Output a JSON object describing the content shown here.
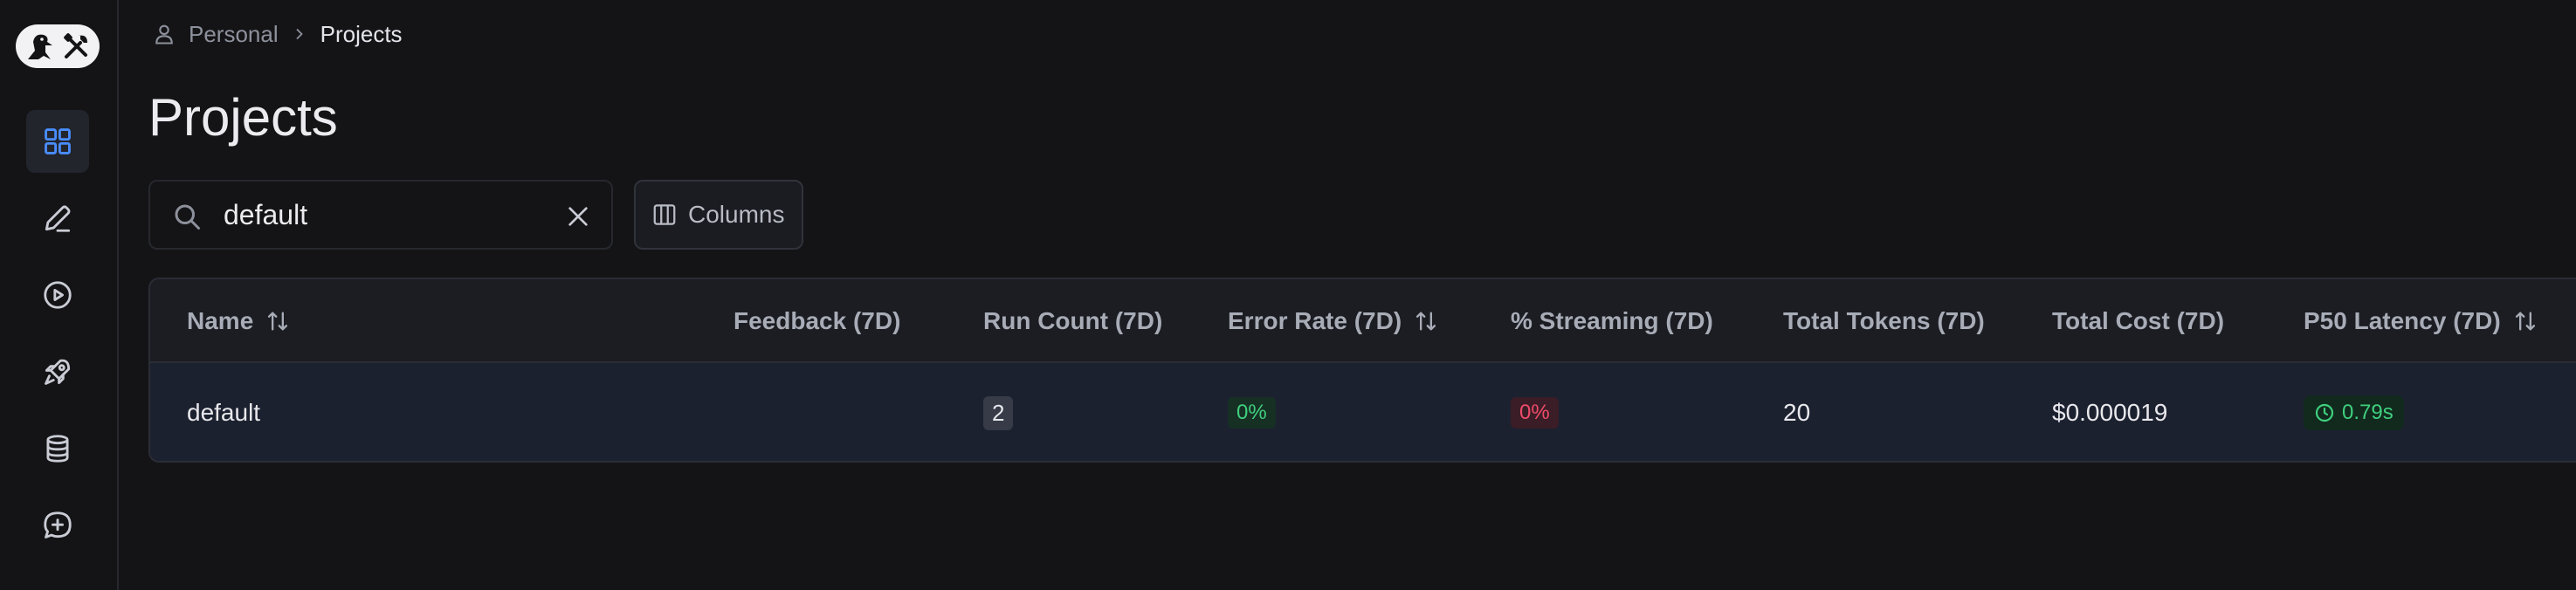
{
  "app": {
    "logo_alt": "LangSmith"
  },
  "sidebar": {
    "items": [
      {
        "icon": "grid-icon",
        "active": true
      },
      {
        "icon": "pencil-icon",
        "active": false
      },
      {
        "icon": "play-circle-icon",
        "active": false
      },
      {
        "icon": "rocket-icon",
        "active": false
      },
      {
        "icon": "database-icon",
        "active": false
      },
      {
        "icon": "chat-plus-icon",
        "active": false
      }
    ]
  },
  "breadcrumb": {
    "workspace": "Personal",
    "current": "Projects"
  },
  "page": {
    "title": "Projects"
  },
  "search": {
    "value": "default",
    "placeholder": ""
  },
  "toolbar": {
    "columns_label": "Columns"
  },
  "table": {
    "headers": [
      "Name",
      "Feedback (7D)",
      "Run Count (7D)",
      "Error Rate (7D)",
      "% Streaming (7D)",
      "Total Tokens (7D)",
      "Total Cost (7D)",
      "P50 Latency (7D)"
    ],
    "rows": [
      {
        "name": "default",
        "feedback": "",
        "run_count": "2",
        "error_rate": "0%",
        "streaming": "0%",
        "total_tokens": "20",
        "total_cost": "$0.000019",
        "p50_latency": "0.79s"
      }
    ]
  },
  "colors": {
    "accent": "#4a8dff",
    "success": "#3fcf7e",
    "danger": "#ef4b6a",
    "background": "#141417"
  }
}
